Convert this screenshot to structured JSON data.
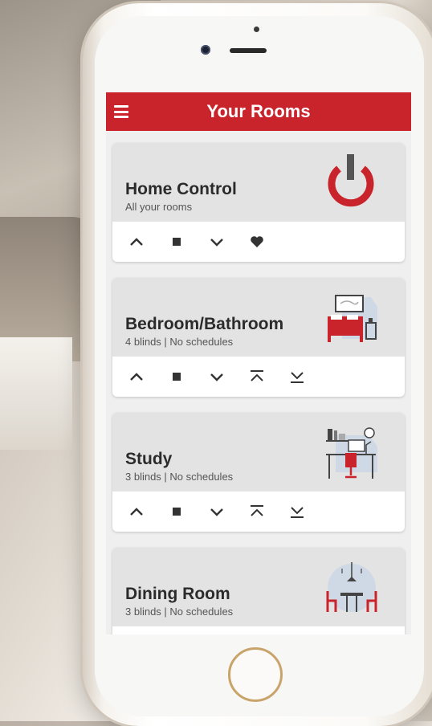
{
  "app": {
    "title": "Your Rooms",
    "accent_color": "#c9242b"
  },
  "rooms": [
    {
      "name": "Home Control",
      "subtitle": "All your rooms",
      "icon": "power-icon",
      "controls": [
        "up-chevron-icon",
        "stop-square-icon",
        "down-chevron-icon",
        "heart-icon"
      ]
    },
    {
      "name": "Bedroom/Bathroom",
      "subtitle": "4 blinds | No schedules",
      "icon": "bedroom-icon",
      "controls": [
        "up-chevron-icon",
        "stop-square-icon",
        "down-chevron-icon",
        "fully-open-icon",
        "fully-close-icon"
      ]
    },
    {
      "name": "Study",
      "subtitle": "3 blinds | No schedules",
      "icon": "study-desk-icon",
      "controls": [
        "up-chevron-icon",
        "stop-square-icon",
        "down-chevron-icon",
        "fully-open-icon",
        "fully-close-icon"
      ]
    },
    {
      "name": "Dining Room",
      "subtitle": "3 blinds | No schedules",
      "icon": "dining-room-icon",
      "controls": []
    }
  ]
}
